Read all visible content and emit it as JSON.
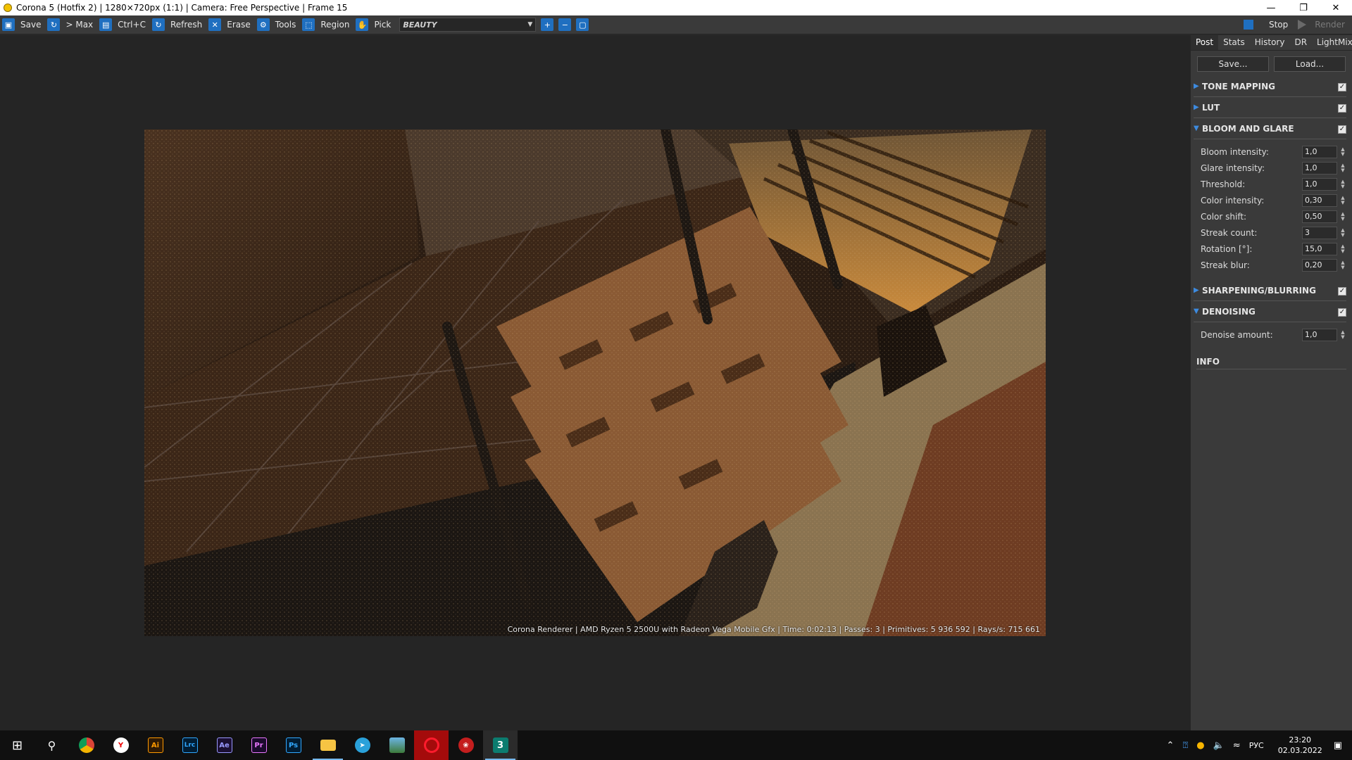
{
  "window": {
    "title": "Corona 5 (Hotfix 2) | 1280×720px (1:1) | Camera: Free Perspective | Frame 15",
    "minimize_icon": "minimize-icon",
    "restore_icon": "restore-icon",
    "close_icon": "close-icon"
  },
  "toolbar": {
    "save": "Save",
    "max": "> Max",
    "copy": "Ctrl+C",
    "refresh": "Refresh",
    "erase": "Erase",
    "tools": "Tools",
    "region": "Region",
    "pick": "Pick",
    "render_pass": "BEAUTY",
    "stop": "Stop",
    "render": "Render"
  },
  "render": {
    "stamp": "Corona Renderer | AMD Ryzen 5 2500U with Radeon Vega Mobile Gfx  | Time: 0:02:13 | Passes: 3 | Primitives: 5 936 592 | Rays/s: 715 661"
  },
  "panel": {
    "tabs": [
      "Post",
      "Stats",
      "History",
      "DR",
      "LightMix"
    ],
    "active_tab": "Post",
    "save_btn": "Save...",
    "load_btn": "Load...",
    "sections": {
      "tone_mapping": {
        "label": "TONE MAPPING",
        "checked": true,
        "expanded": false
      },
      "lut": {
        "label": "LUT",
        "checked": true,
        "expanded": false
      },
      "bloom_glare": {
        "label": "BLOOM AND GLARE",
        "checked": true,
        "expanded": true,
        "params": [
          {
            "label": "Bloom intensity:",
            "value": "1,0"
          },
          {
            "label": "Glare intensity:",
            "value": "1,0"
          },
          {
            "label": "Threshold:",
            "value": "1,0"
          },
          {
            "label": "Color intensity:",
            "value": "0,30"
          },
          {
            "label": "Color shift:",
            "value": "0,50"
          },
          {
            "label": "Streak count:",
            "value": "3"
          },
          {
            "label": "Rotation [°]:",
            "value": "15,0"
          },
          {
            "label": "Streak blur:",
            "value": "0,20"
          }
        ]
      },
      "sharpening": {
        "label": "SHARPENING/BLURRING",
        "checked": true,
        "expanded": false
      },
      "denoising": {
        "label": "DENOISING",
        "checked": true,
        "expanded": true,
        "params": [
          {
            "label": "Denoise amount:",
            "value": "1,0"
          }
        ]
      },
      "info": {
        "label": "INFO"
      }
    }
  },
  "taskbar": {
    "apps": [
      "start",
      "search",
      "chrome",
      "yandex",
      "illustrator",
      "lightroom-classic",
      "after-effects",
      "premiere-pro",
      "photoshop",
      "file-explorer",
      "telegram",
      "photos",
      "opera",
      "app",
      "3ds-max"
    ],
    "app_labels": {
      "illustrator": "Ai",
      "lightroom": "Lrc",
      "after_effects": "Ae",
      "premiere": "Pr",
      "photoshop": "Ps",
      "max": "3"
    },
    "language": "РУС",
    "time": "23:20",
    "date": "02.03.2022"
  },
  "colors": {
    "accent": "#1f6fc0",
    "panel_bg": "#3a3a3a",
    "viewport_bg": "#252525",
    "taskbar_bg": "#101010"
  }
}
